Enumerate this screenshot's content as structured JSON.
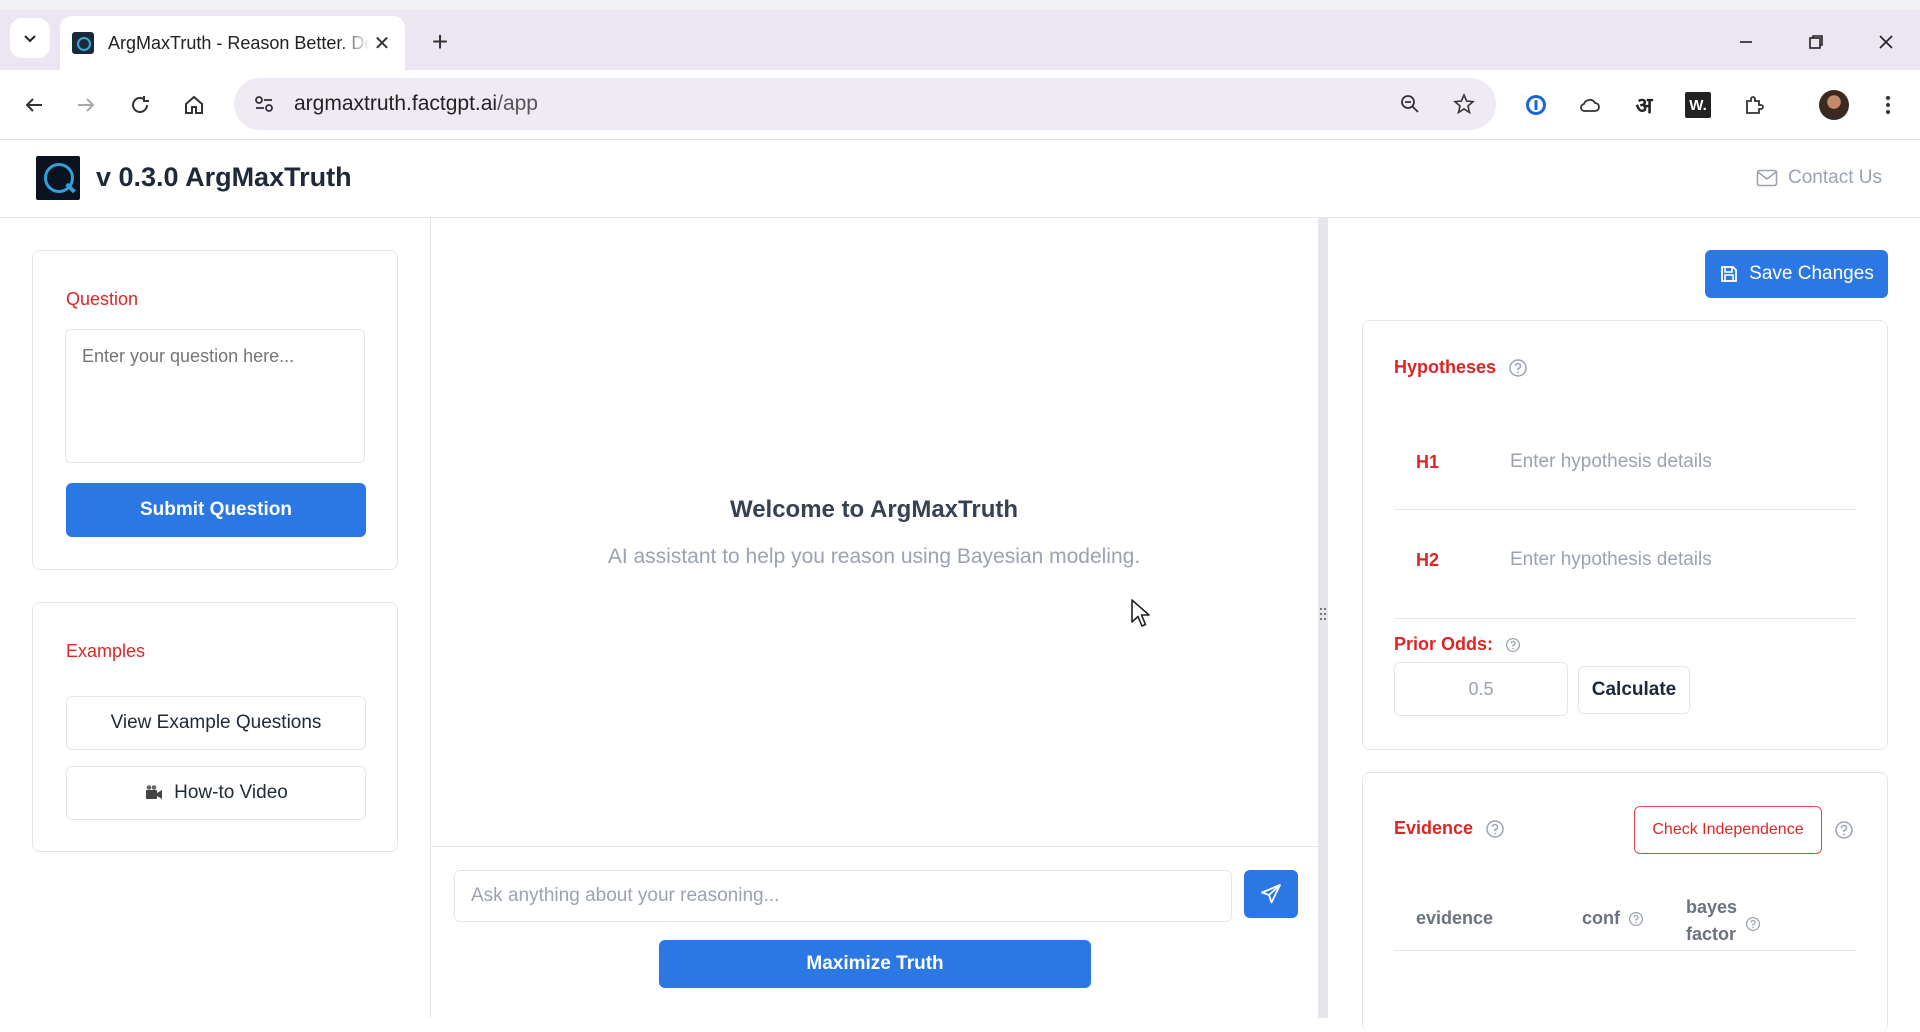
{
  "browser": {
    "tab_title": "ArgMaxTruth - Reason Better. Decide Better.",
    "url_host": "argmaxtruth.factgpt.ai",
    "url_path": "/app",
    "ext_hindi_glyph": "अ",
    "ext_w_glyph": "W."
  },
  "app": {
    "title": "v 0.3.0 ArgMaxTruth",
    "contact_label": "Contact Us"
  },
  "left": {
    "question_label": "Question",
    "question_placeholder": "Enter your question here...",
    "submit_label": "Submit Question",
    "examples_label": "Examples",
    "view_examples_label": "View Example Questions",
    "video_label": "How-to Video"
  },
  "chat": {
    "welcome_title": "Welcome to ArgMaxTruth",
    "welcome_subtitle": "AI assistant to help you reason using Bayesian modeling.",
    "input_placeholder": "Ask anything about your reasoning...",
    "maximize_label": "Maximize Truth"
  },
  "right": {
    "save_label": "Save Changes",
    "hypotheses_label": "Hypotheses",
    "hypotheses": [
      {
        "id": "H1",
        "placeholder": "Enter hypothesis details"
      },
      {
        "id": "H2",
        "placeholder": "Enter hypothesis details"
      }
    ],
    "prior_odds_label": "Prior Odds:",
    "prior_odds_value": "0.5",
    "calculate_label": "Calculate",
    "evidence_label": "Evidence",
    "check_independence_label": "Check Independence",
    "columns": {
      "evidence": "evidence",
      "conf": "conf",
      "bayes_factor_line1": "bayes",
      "bayes_factor_line2": "factor"
    }
  },
  "colors": {
    "primary": "#2b78e4",
    "accent_red": "#dc2626",
    "tabbar": "#ece6f3"
  }
}
